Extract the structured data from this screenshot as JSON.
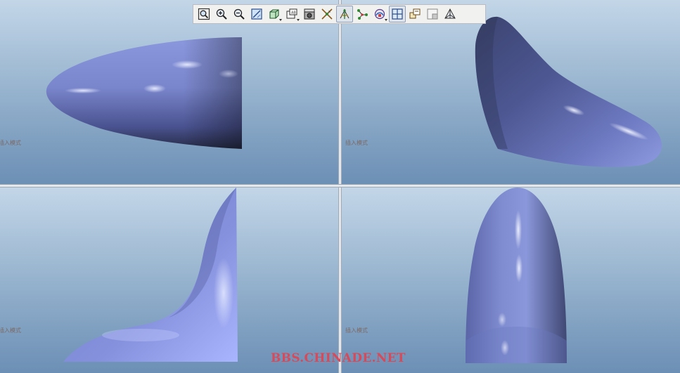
{
  "toolbar": {
    "buttons": [
      {
        "icon": "refit-icon",
        "active": false,
        "dropdown": false
      },
      {
        "icon": "zoom-in-icon",
        "active": false,
        "dropdown": false
      },
      {
        "icon": "zoom-out-icon",
        "active": false,
        "dropdown": false
      },
      {
        "icon": "repaint-icon",
        "active": false,
        "dropdown": false
      },
      {
        "icon": "display-style-icon",
        "active": false,
        "dropdown": true
      },
      {
        "icon": "saved-views-icon",
        "active": false,
        "dropdown": true
      },
      {
        "icon": "camera-icon",
        "active": false,
        "dropdown": false
      },
      {
        "icon": "spin-center-icon",
        "active": false,
        "dropdown": false
      },
      {
        "icon": "datum-planes-icon",
        "active": true,
        "dropdown": false
      },
      {
        "icon": "datum-points-icon",
        "active": false,
        "dropdown": false
      },
      {
        "icon": "annotation-display-icon",
        "active": false,
        "dropdown": true
      },
      {
        "icon": "multi-viewport-icon",
        "active": true,
        "dropdown": false
      },
      {
        "icon": "view-manager-icon",
        "active": false,
        "dropdown": false
      },
      {
        "icon": "section-icon",
        "active": false,
        "dropdown": false
      },
      {
        "icon": "perspective-icon",
        "active": false,
        "dropdown": false
      }
    ]
  },
  "viewports": {
    "top_left": {
      "label": "插入模式"
    },
    "top_right": {
      "label": "插入模式"
    },
    "bottom_left": {
      "label": "插入模式"
    },
    "bottom_right": {
      "label": "插入模式"
    }
  },
  "colors": {
    "surface": "#7f8ccf",
    "surface_highlight": "#c9d2ff",
    "surface_shadow": "#2c3350",
    "background_top": "#c3d6e8",
    "background_bottom": "#6c8fb5"
  },
  "watermark": "BBS.CHINADE.NET"
}
